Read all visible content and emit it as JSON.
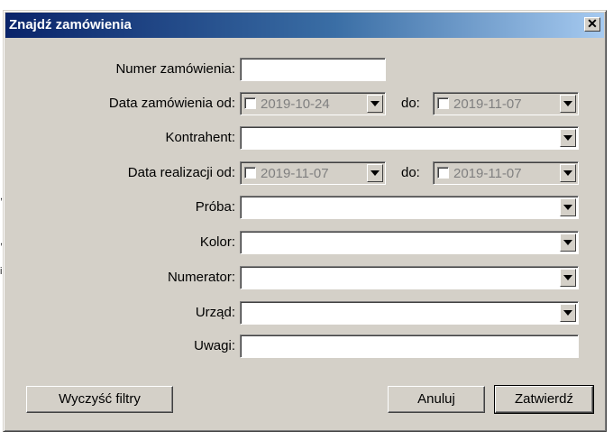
{
  "dialog": {
    "title": "Znajdź zamówienia",
    "close_label": "✕"
  },
  "form": {
    "order_number": {
      "label": "Numer zamówienia:",
      "value": ""
    },
    "order_date": {
      "label": "Data zamówienia od:",
      "from": "2019-10-24",
      "to_label": "do:",
      "to": "2019-11-07",
      "from_checked": false,
      "to_checked": false
    },
    "contractor": {
      "label": "Kontrahent:",
      "value": ""
    },
    "realization_date": {
      "label": "Data realizacji od:",
      "from": "2019-11-07",
      "to_label": "do:",
      "to": "2019-11-07",
      "from_checked": false,
      "to_checked": false
    },
    "sample": {
      "label": "Próba:",
      "value": ""
    },
    "color": {
      "label": "Kolor:",
      "value": ""
    },
    "numerator": {
      "label": "Numerator:",
      "value": ""
    },
    "office": {
      "label": "Urząd:",
      "value": ""
    },
    "notes": {
      "label": "Uwagi:",
      "value": ""
    }
  },
  "buttons": {
    "clear": "Wyczyść filtry",
    "cancel": "Anuluj",
    "confirm": "Zatwierdź"
  },
  "colors": {
    "title_gradient_start": "#0a246a",
    "title_gradient_end": "#a6caf0",
    "dialog_face": "#d4d0c8"
  }
}
